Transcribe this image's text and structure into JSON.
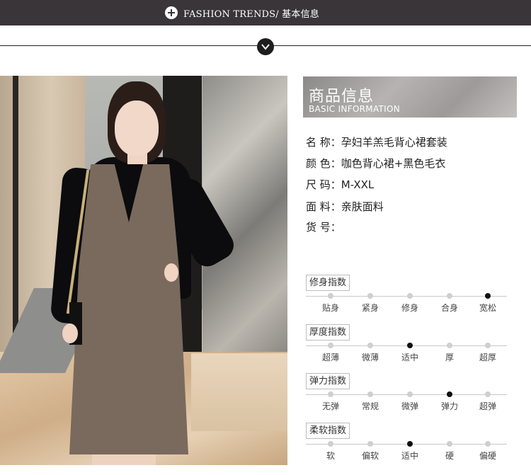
{
  "banner": {
    "title": "FASHION TRENDS/ 基本信息"
  },
  "info_header": {
    "title": "商品信息",
    "subtitle": "BASIC INFORMATION"
  },
  "product": {
    "name_row": "名 称：孕妇羊羔毛背心裙套装",
    "color_row": "颜 色：咖色背心裙+黑色毛衣",
    "size_row": "尺 码：M-XXL",
    "material_row": "面 料：亲肤面料",
    "sku_row": "货 号："
  },
  "scales": [
    {
      "label": "修身指数",
      "options": [
        "贴身",
        "紧身",
        "修身",
        "合身",
        "宽松"
      ],
      "selected": 4
    },
    {
      "label": "厚度指数",
      "options": [
        "超薄",
        "微薄",
        "适中",
        "厚",
        "超厚"
      ],
      "selected": 2
    },
    {
      "label": "弹力指数",
      "options": [
        "无弹",
        "常规",
        "微弹",
        "弹力",
        "超弹"
      ],
      "selected": 3
    },
    {
      "label": "柔软指数",
      "options": [
        "软",
        "偏软",
        "适中",
        "硬",
        "偏硬"
      ],
      "selected": 2
    }
  ],
  "colors": {
    "banner_bg": "#3a3538",
    "selected_dot": "#111111",
    "dot": "#cfcfcf"
  }
}
